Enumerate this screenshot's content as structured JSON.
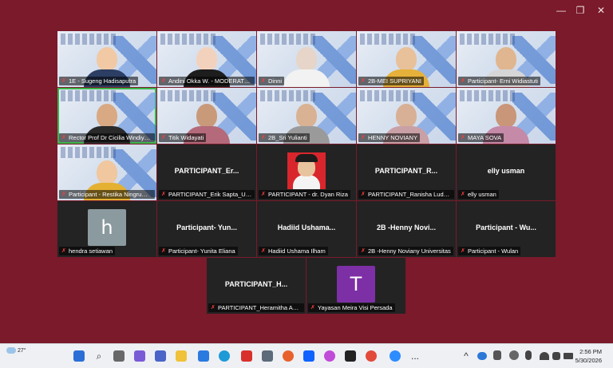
{
  "window": {
    "controls": {
      "minimize": "—",
      "restore": "❐",
      "close": "✕"
    }
  },
  "tiles": [
    {
      "name": "1E - Sugeng Hadisaputra",
      "kind": "video",
      "skin": "#f1c9a5",
      "cloth": "#2c3e63"
    },
    {
      "name": "Andini Okka W. - MODERATOR",
      "kind": "video",
      "skin": "#f2d2bd",
      "cloth": "#1d1d1d"
    },
    {
      "name": "Dinni",
      "kind": "video",
      "skin": "#e6d5c8",
      "cloth": "#f2f2f2"
    },
    {
      "name": "2B-MEI SUPRIYANI",
      "kind": "video",
      "skin": "#e8c09a",
      "cloth": "#e5b13a"
    },
    {
      "name": "Participant- Erni Widiastuti",
      "kind": "video",
      "skin": "#e0b690",
      "cloth": "#d6d6d6"
    },
    {
      "name": "Rector Prof Dr Cicilia Windiyaningsih",
      "kind": "video",
      "skin": "#d8a983",
      "cloth": "#2a2a2a",
      "active": true
    },
    {
      "name": "Titik Widayati",
      "kind": "video",
      "skin": "#c99a7a",
      "cloth": "#b46a7a"
    },
    {
      "name": "2B_Sri Yulianti",
      "kind": "video",
      "skin": "#d9b294",
      "cloth": "#9a9a9a"
    },
    {
      "name": "HENNY NOVIANY",
      "kind": "video",
      "skin": "#d8b096",
      "cloth": "#c9a0a6"
    },
    {
      "name": "MAYA SOVA",
      "kind": "video",
      "skin": "#c9967a",
      "cloth": "#c48aa7"
    },
    {
      "name": "Participant - Restika Ningrum R",
      "kind": "video",
      "skin": "#f0c79e",
      "cloth": "#e4b133"
    },
    {
      "name": "PARTICIPANT_Erik Sapta_URINDO",
      "kind": "name",
      "big": "PARTICIPANT_Er..."
    },
    {
      "name": "PARTICIPANT - dr. Dyan Riza",
      "kind": "photo"
    },
    {
      "name": "PARTICIPANT_Ranisha Ludyani",
      "kind": "name",
      "big": "PARTICIPANT_R..."
    },
    {
      "name": "elly usman",
      "kind": "name",
      "big": "elly usman"
    },
    {
      "name": "hendra setiawan",
      "kind": "avatar",
      "letter": "h",
      "color": "#8a9a9e"
    },
    {
      "name": "Participant- Yunita Eliana",
      "kind": "name",
      "big": "Participant- Yun..."
    },
    {
      "name": "Hadiid Ushama Ilham",
      "kind": "name",
      "big": "Hadiid Ushama..."
    },
    {
      "name": "2B -Henny Noviany Universitas",
      "kind": "name",
      "big": "2B -Henny Novi..."
    },
    {
      "name": "Participant - Wulan",
      "kind": "name",
      "big": "Participant - Wu..."
    },
    {
      "name": "PARTICIPANT_Heramitha Azahra",
      "kind": "name",
      "big": "PARTICIPANT_H..."
    },
    {
      "name": "Yayasan Meira Visi Persada",
      "kind": "avatar",
      "letter": "T",
      "color": "#7d2fa6"
    }
  ],
  "taskbar": {
    "weather": "27°",
    "time": "2:56 PM",
    "date": "5/30/2026",
    "up_arrow": "^",
    "ellipsis": "..."
  }
}
